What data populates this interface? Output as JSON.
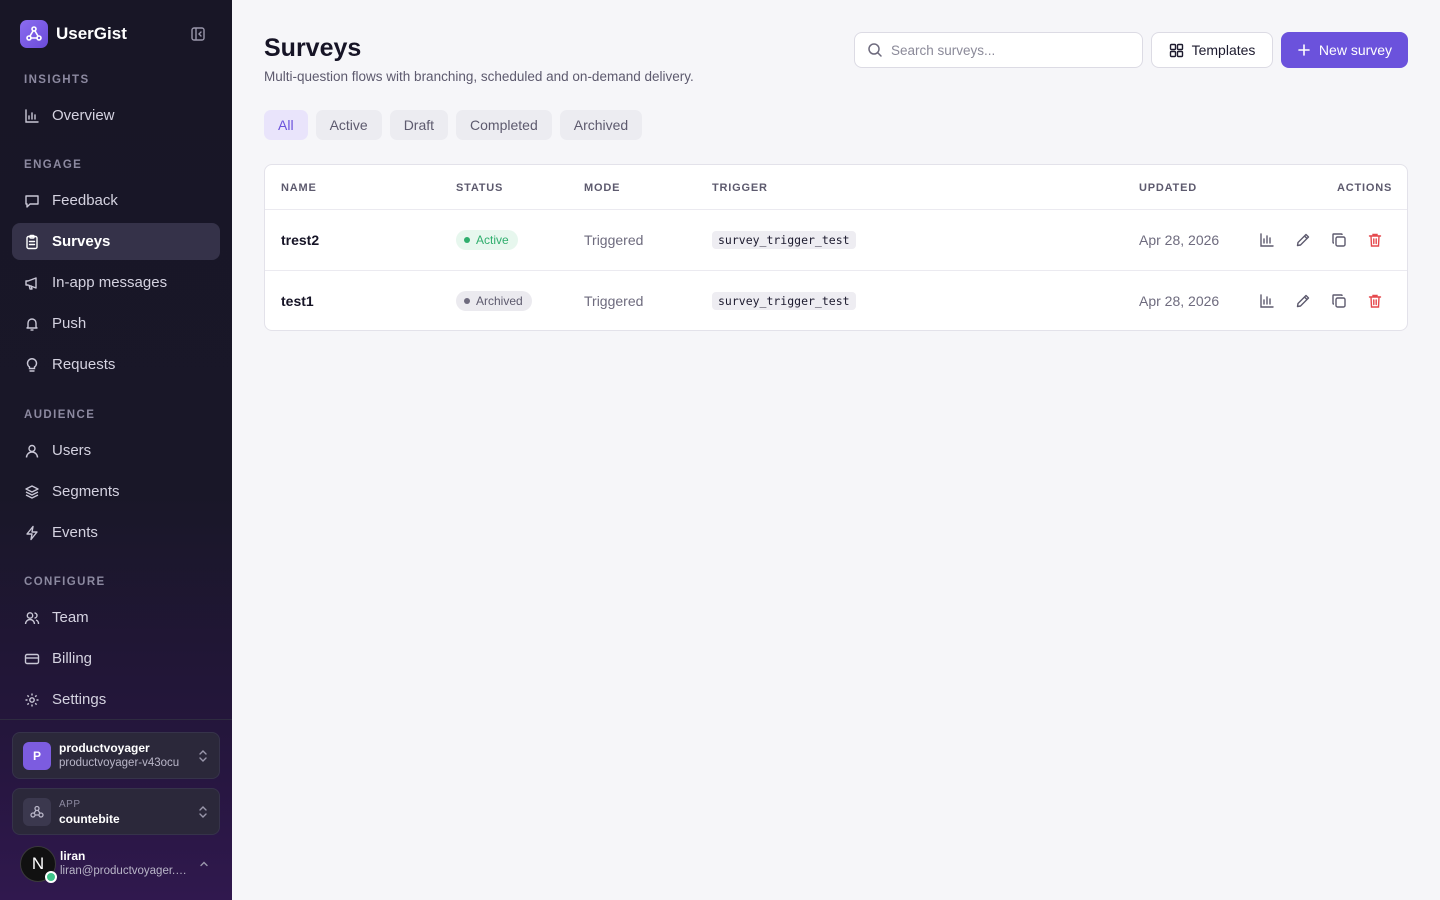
{
  "brand": {
    "name": "UserGist"
  },
  "sidebar": {
    "sections": {
      "insights": "INSIGHTS",
      "engage": "ENGAGE",
      "audience": "AUDIENCE",
      "configure": "CONFIGURE"
    },
    "items": [
      {
        "label": "Overview",
        "icon": "bar-chart-icon"
      },
      {
        "label": "Feedback",
        "icon": "message-square-icon"
      },
      {
        "label": "Surveys",
        "icon": "clipboard-icon",
        "active": true
      },
      {
        "label": "In-app messages",
        "icon": "megaphone-icon"
      },
      {
        "label": "Push",
        "icon": "bell-icon"
      },
      {
        "label": "Requests",
        "icon": "lightbulb-icon"
      },
      {
        "label": "Users",
        "icon": "user-icon"
      },
      {
        "label": "Segments",
        "icon": "layers-icon"
      },
      {
        "label": "Events",
        "icon": "zap-icon"
      },
      {
        "label": "Team",
        "icon": "users-icon"
      },
      {
        "label": "Billing",
        "icon": "credit-card-icon"
      },
      {
        "label": "Settings",
        "icon": "gear-icon"
      }
    ],
    "org": {
      "initial": "P",
      "name": "productvoyager",
      "slug": "productvoyager-v43ocu"
    },
    "app": {
      "caption": "APP",
      "name": "countebite"
    },
    "user": {
      "initial": "N",
      "name": "liran",
      "email": "liran@productvoyager.co..."
    }
  },
  "header": {
    "title": "Surveys",
    "subtitle": "Multi-question flows with branching, scheduled and on-demand delivery.",
    "search_placeholder": "Search surveys...",
    "templates_label": "Templates",
    "new_label": "New survey"
  },
  "tabs": [
    {
      "label": "All",
      "active": true
    },
    {
      "label": "Active"
    },
    {
      "label": "Draft"
    },
    {
      "label": "Completed"
    },
    {
      "label": "Archived"
    }
  ],
  "table": {
    "columns": [
      "NAME",
      "STATUS",
      "MODE",
      "TRIGGER",
      "UPDATED",
      "ACTIONS"
    ],
    "rows": [
      {
        "name": "trest2",
        "status": "Active",
        "mode": "Triggered",
        "trigger": "survey_trigger_test",
        "updated": "Apr 28, 2026"
      },
      {
        "name": "test1",
        "status": "Archived",
        "mode": "Triggered",
        "trigger": "survey_trigger_test",
        "updated": "Apr 28, 2026"
      }
    ]
  },
  "colors": {
    "accent": "#6b52dc",
    "active_status": "#2fae6d",
    "delete": "#e5484d",
    "sidebar_bg": "#181626"
  }
}
